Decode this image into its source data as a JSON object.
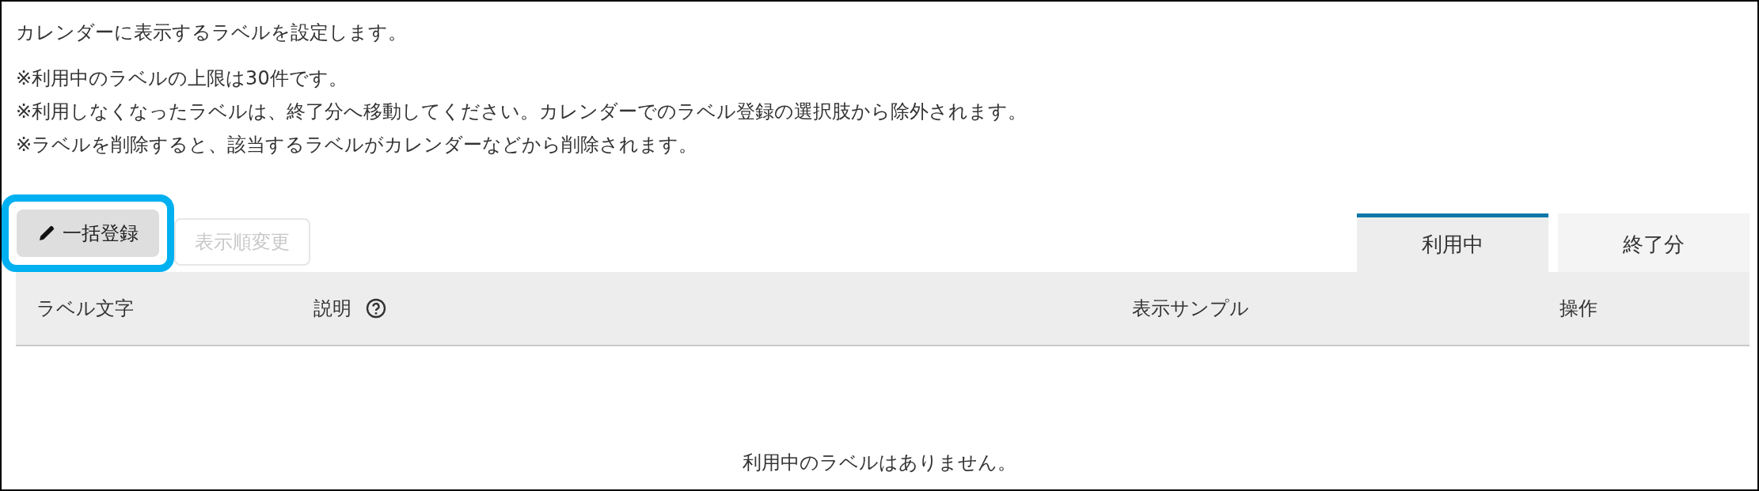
{
  "intro": "カレンダーに表示するラベルを設定します。",
  "notes": [
    "※利用中のラベルの上限は30件です。",
    "※利用しなくなったラベルは、終了分へ移動してください。カレンダーでのラベル登録の選択肢から除外されます。",
    "※ラベルを削除すると、該当するラベルがカレンダーなどから削除されます。"
  ],
  "buttons": [
    {
      "label": "一括登録",
      "kind": "edit",
      "disabled": false,
      "highlighted": true
    },
    {
      "label": "表示順変更",
      "kind": "plain",
      "disabled": true,
      "highlighted": false
    }
  ],
  "tabs": [
    {
      "label": "利用中",
      "selected": true
    },
    {
      "label": "終了分",
      "selected": false
    }
  ],
  "table": {
    "columns": [
      {
        "label": "ラベル文字",
        "help": false
      },
      {
        "label": "説明",
        "help": true
      },
      {
        "label": "表示サンプル",
        "help": false
      },
      {
        "label": "操作",
        "help": false
      }
    ],
    "empty_message": "利用中のラベルはありません。"
  }
}
